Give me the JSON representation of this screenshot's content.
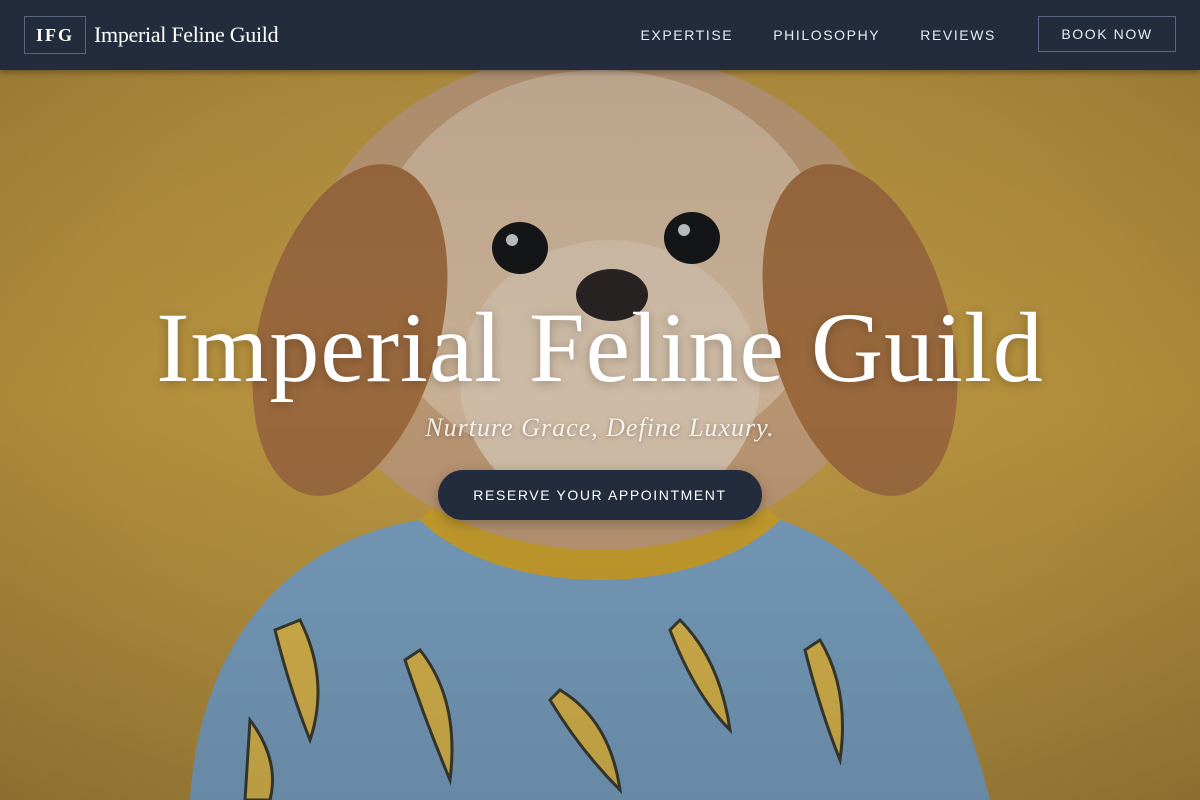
{
  "navbar": {
    "logo_text": "IFG",
    "brand_name": "Imperial Feline Guild",
    "links": [
      {
        "label": "EXPERTISE"
      },
      {
        "label": "PHILOSOPHY"
      },
      {
        "label": "REVIEWS"
      }
    ],
    "cta_label": "BOOK NOW"
  },
  "hero": {
    "title": "Imperial Feline Guild",
    "subtitle": "Nurture Grace, Define Luxury.",
    "cta_label": "RESERVE YOUR APPOINTMENT",
    "background_image": "dog-in-banana-shirt-photo"
  },
  "colors": {
    "nav_bg": "#222c3c",
    "hero_bg": "#c9a142",
    "button_bg": "#222c3c"
  }
}
